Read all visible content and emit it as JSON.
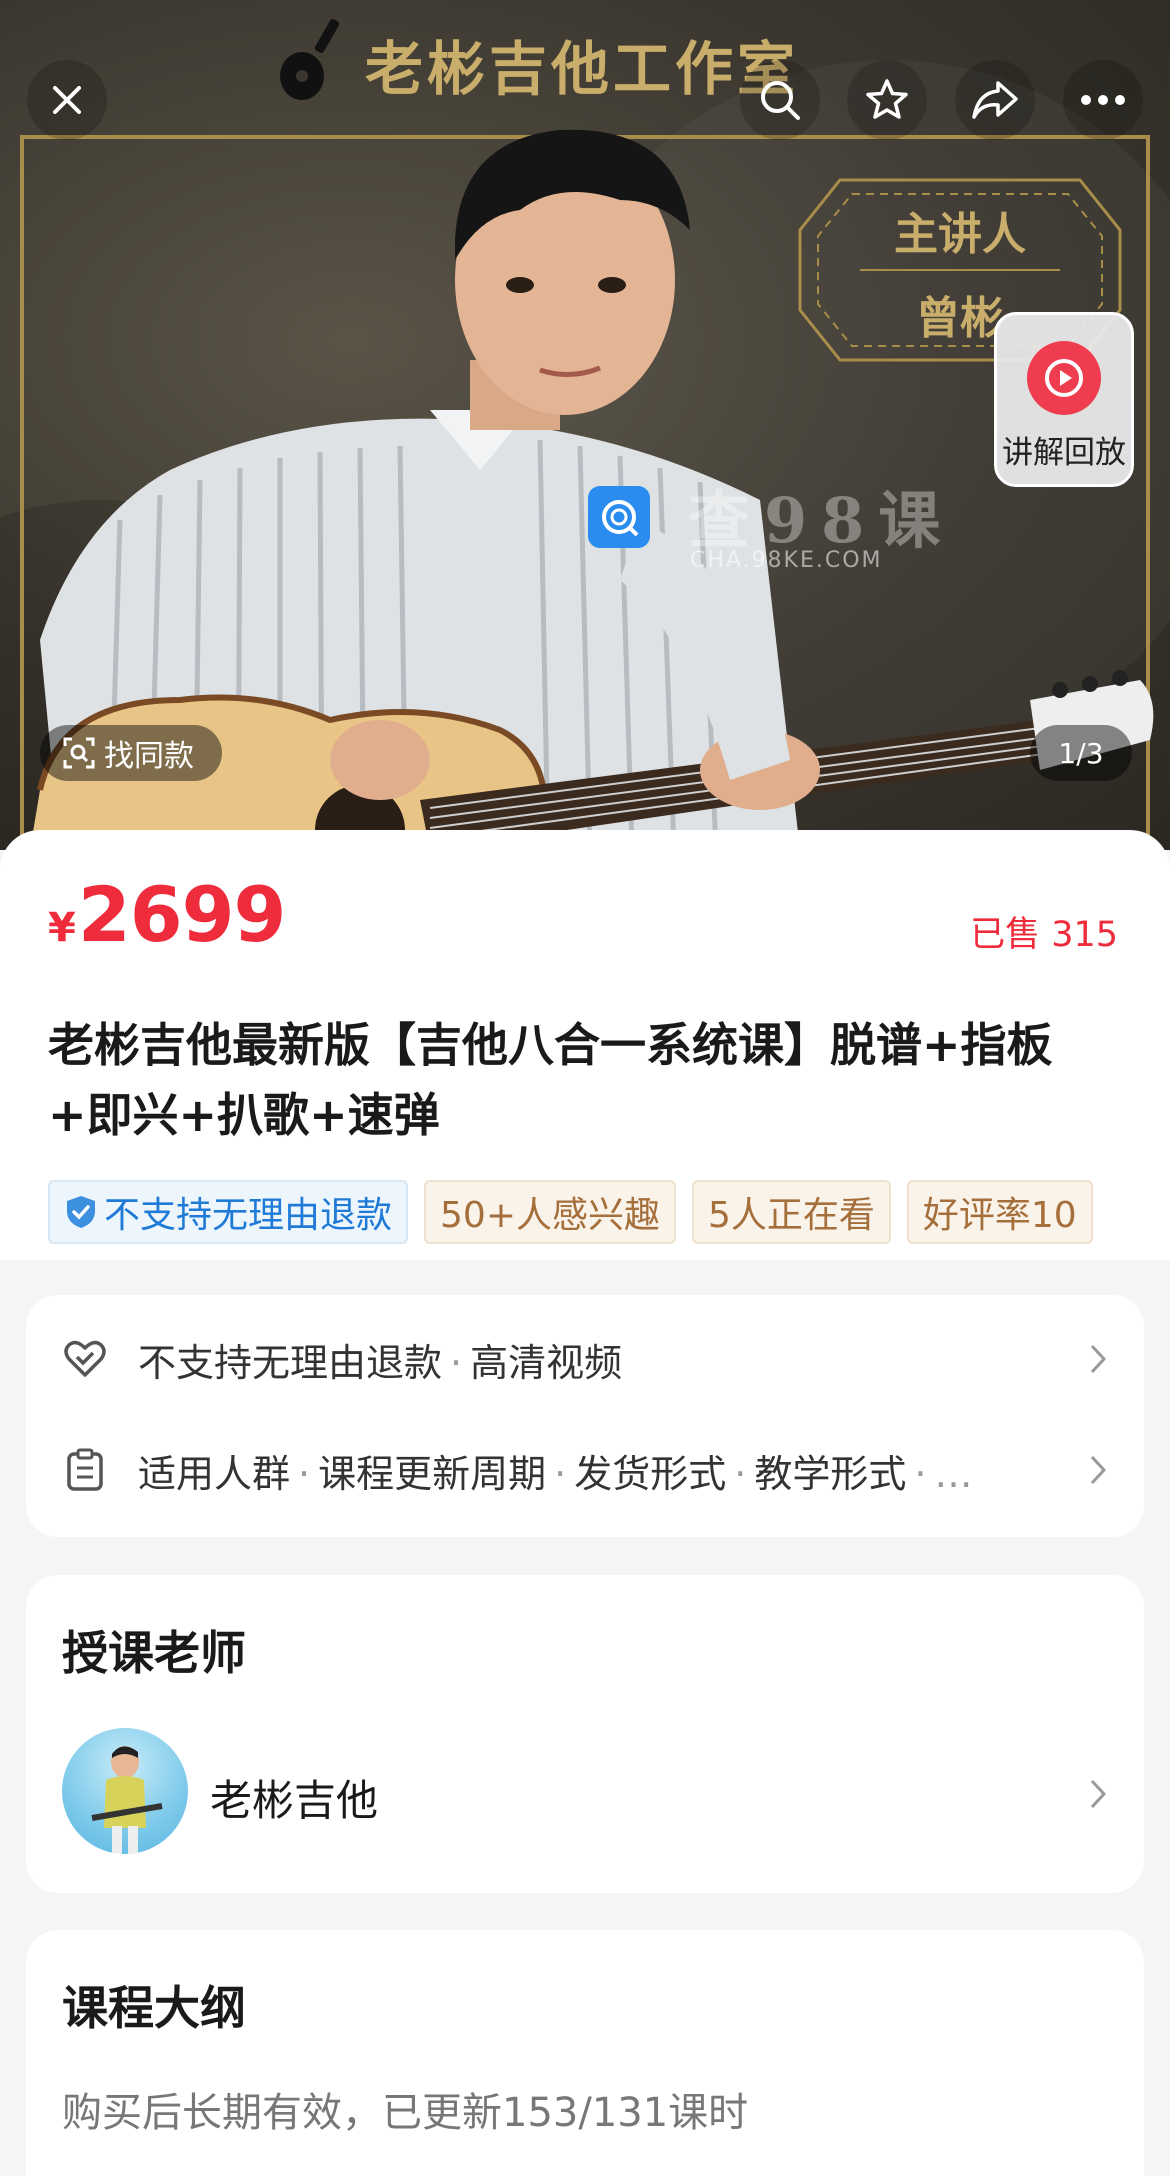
{
  "hero": {
    "studio_title": "老彬吉他工作室",
    "speaker_label": "主讲人",
    "speaker_name": "曾彬",
    "replay_label": "讲解回放",
    "find_same_label": "找同款",
    "page_indicator": "1/3",
    "watermark_cn": "查98课",
    "watermark_en": "CHA.98KE.COM"
  },
  "product": {
    "currency": "¥",
    "price": "2699",
    "sold": "已售 315",
    "title": "老彬吉他最新版【吉他八合一系统课】脱谱+指板+即兴+扒歌+速弹",
    "tags": [
      {
        "label": "不支持无理由退款",
        "style": "blue"
      },
      {
        "label": "50+人感兴趣",
        "style": "beige"
      },
      {
        "label": "5人正在看",
        "style": "beige"
      },
      {
        "label": "好评率10",
        "style": "beige"
      }
    ]
  },
  "services": {
    "refund": "不支持无理由退款",
    "quality": "高清视频",
    "params": [
      "适用人群",
      "课程更新周期",
      "发货形式",
      "教学形式"
    ],
    "params_more": "…"
  },
  "teacher": {
    "heading": "授课老师",
    "name": "老彬吉他"
  },
  "outline": {
    "heading": "课程大纲",
    "subtitle": "购买后长期有效，已更新153/131课时"
  },
  "colors": {
    "accent_red": "#ee2c3c",
    "gold": "#c9ad6b",
    "tag_blue": "#1f7ad8",
    "tag_brown": "#a56f3c"
  },
  "icons": [
    "close-icon",
    "search-icon",
    "star-icon",
    "share-icon",
    "more-icon",
    "play-icon",
    "scan-icon",
    "shield-icon",
    "heart-check-icon",
    "clipboard-icon",
    "chevron-right-icon"
  ]
}
